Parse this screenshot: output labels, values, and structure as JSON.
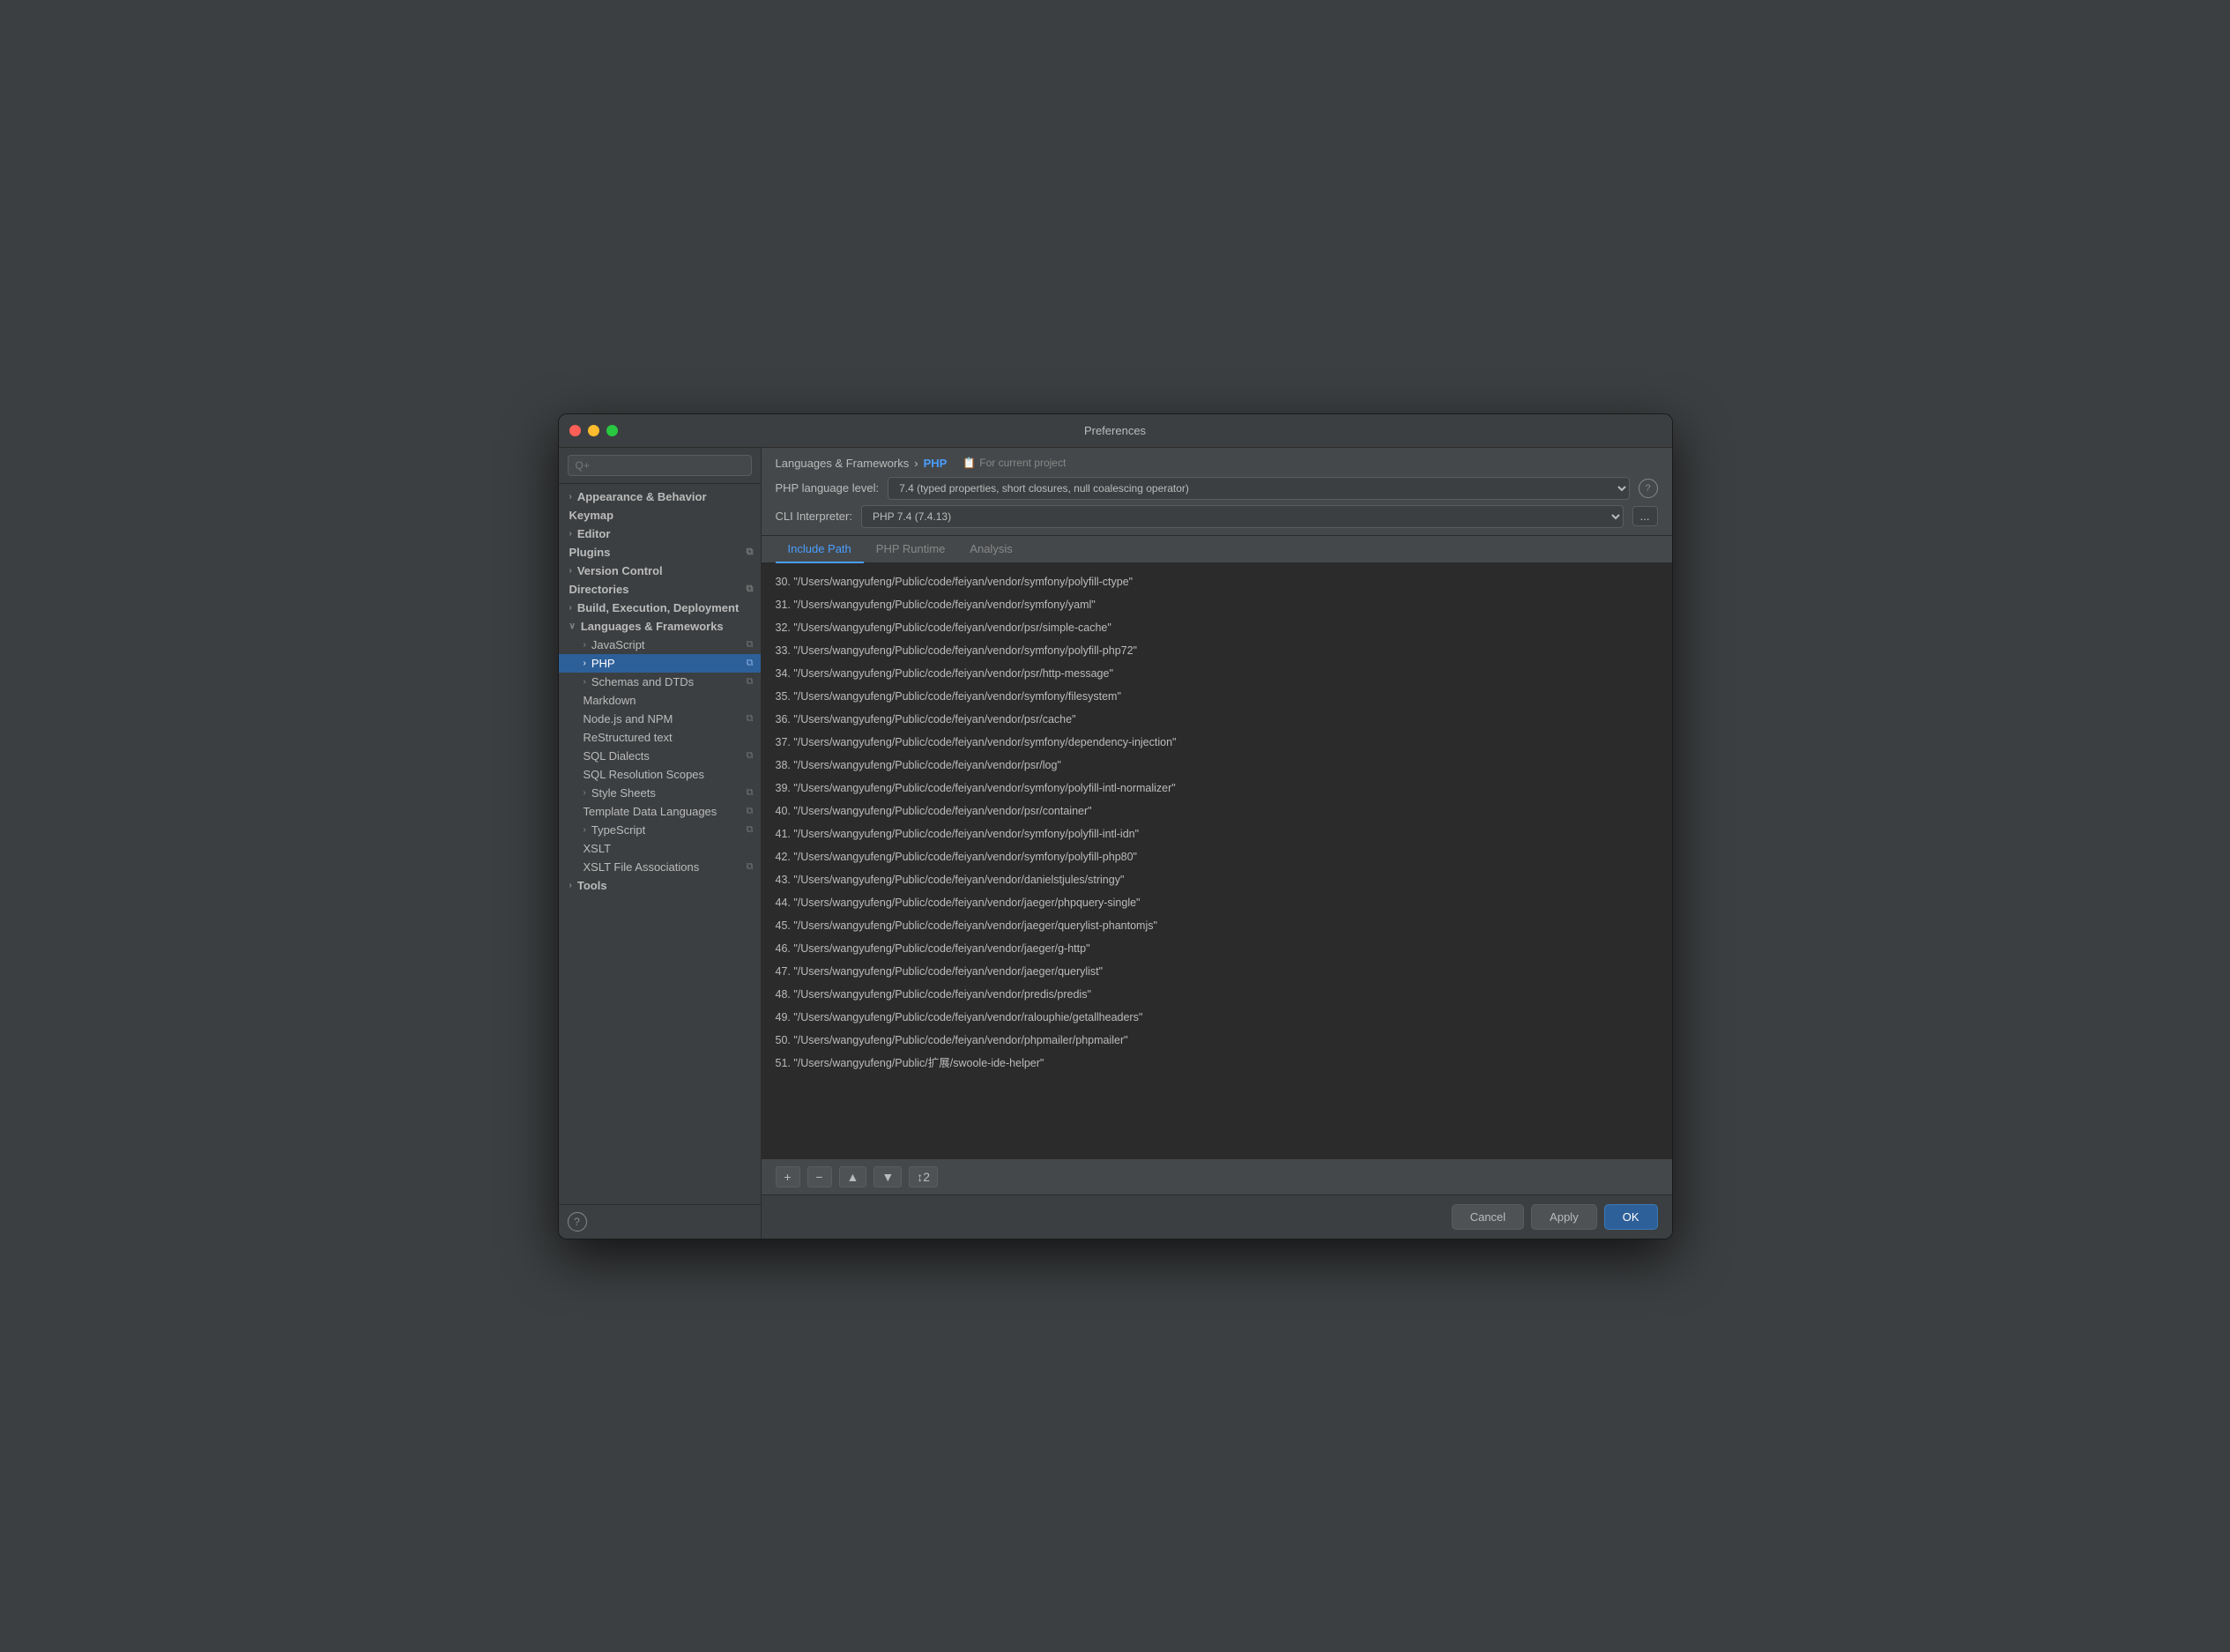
{
  "window": {
    "title": "Preferences"
  },
  "sidebar": {
    "search_placeholder": "Q+",
    "items": [
      {
        "id": "appearance",
        "label": "Appearance & Behavior",
        "level": 0,
        "expandable": true,
        "bold": true
      },
      {
        "id": "keymap",
        "label": "Keymap",
        "level": 0,
        "expandable": false,
        "bold": true
      },
      {
        "id": "editor",
        "label": "Editor",
        "level": 0,
        "expandable": true,
        "bold": true
      },
      {
        "id": "plugins",
        "label": "Plugins",
        "level": 0,
        "expandable": false,
        "bold": true,
        "has_icon": true
      },
      {
        "id": "version-control",
        "label": "Version Control",
        "level": 0,
        "expandable": true,
        "bold": true
      },
      {
        "id": "directories",
        "label": "Directories",
        "level": 0,
        "expandable": false,
        "bold": true,
        "has_icon": true
      },
      {
        "id": "build",
        "label": "Build, Execution, Deployment",
        "level": 0,
        "expandable": true,
        "bold": true
      },
      {
        "id": "languages",
        "label": "Languages & Frameworks",
        "level": 0,
        "expandable": true,
        "bold": true,
        "expanded": true
      },
      {
        "id": "javascript",
        "label": "JavaScript",
        "level": 1,
        "expandable": true,
        "has_icon": true
      },
      {
        "id": "php",
        "label": "PHP",
        "level": 1,
        "expandable": true,
        "selected": true,
        "has_icon": true
      },
      {
        "id": "schemas",
        "label": "Schemas and DTDs",
        "level": 1,
        "expandable": true,
        "has_icon": true
      },
      {
        "id": "markdown",
        "label": "Markdown",
        "level": 1,
        "expandable": false
      },
      {
        "id": "nodejs",
        "label": "Node.js and NPM",
        "level": 1,
        "expandable": false,
        "has_icon": true
      },
      {
        "id": "restructured",
        "label": "ReStructured text",
        "level": 1,
        "expandable": false
      },
      {
        "id": "sql-dialects",
        "label": "SQL Dialects",
        "level": 1,
        "expandable": false,
        "has_icon": true
      },
      {
        "id": "sql-resolution",
        "label": "SQL Resolution Scopes",
        "level": 1,
        "expandable": false
      },
      {
        "id": "stylesheets",
        "label": "Style Sheets",
        "level": 1,
        "expandable": true,
        "has_icon": true
      },
      {
        "id": "template",
        "label": "Template Data Languages",
        "level": 1,
        "expandable": false,
        "has_icon": true
      },
      {
        "id": "typescript",
        "label": "TypeScript",
        "level": 1,
        "expandable": true,
        "has_icon": true
      },
      {
        "id": "xslt",
        "label": "XSLT",
        "level": 1,
        "expandable": false
      },
      {
        "id": "xslt-file",
        "label": "XSLT File Associations",
        "level": 1,
        "expandable": false,
        "has_icon": true
      },
      {
        "id": "tools",
        "label": "Tools",
        "level": 0,
        "expandable": true,
        "bold": true
      }
    ]
  },
  "panel": {
    "breadcrumb": {
      "parent": "Languages & Frameworks",
      "separator": "›",
      "current": "PHP",
      "project_icon": "📋",
      "project_label": "For current project"
    },
    "lang_level": {
      "label": "PHP language level:",
      "value": "7.4 (typed properties, short closures, null coalescing operator)"
    },
    "cli": {
      "label": "CLI Interpreter:",
      "value": "PHP 7.4 (7.4.13)"
    },
    "tabs": [
      {
        "id": "include-path",
        "label": "Include Path",
        "active": true
      },
      {
        "id": "php-runtime",
        "label": "PHP Runtime",
        "active": false
      },
      {
        "id": "analysis",
        "label": "Analysis",
        "active": false
      }
    ],
    "paths": [
      "30.  \"/Users/wangyufeng/Public/code/feiyan/vendor/symfony/polyfill-ctype\"",
      "31.  \"/Users/wangyufeng/Public/code/feiyan/vendor/symfony/yaml\"",
      "32.  \"/Users/wangyufeng/Public/code/feiyan/vendor/psr/simple-cache\"",
      "33.  \"/Users/wangyufeng/Public/code/feiyan/vendor/symfony/polyfill-php72\"",
      "34.  \"/Users/wangyufeng/Public/code/feiyan/vendor/psr/http-message\"",
      "35.  \"/Users/wangyufeng/Public/code/feiyan/vendor/symfony/filesystem\"",
      "36.  \"/Users/wangyufeng/Public/code/feiyan/vendor/psr/cache\"",
      "37.  \"/Users/wangyufeng/Public/code/feiyan/vendor/symfony/dependency-injection\"",
      "38.  \"/Users/wangyufeng/Public/code/feiyan/vendor/psr/log\"",
      "39.  \"/Users/wangyufeng/Public/code/feiyan/vendor/symfony/polyfill-intl-normalizer\"",
      "40.  \"/Users/wangyufeng/Public/code/feiyan/vendor/psr/container\"",
      "41.  \"/Users/wangyufeng/Public/code/feiyan/vendor/symfony/polyfill-intl-idn\"",
      "42.  \"/Users/wangyufeng/Public/code/feiyan/vendor/symfony/polyfill-php80\"",
      "43.  \"/Users/wangyufeng/Public/code/feiyan/vendor/danielstjules/stringy\"",
      "44.  \"/Users/wangyufeng/Public/code/feiyan/vendor/jaeger/phpquery-single\"",
      "45.  \"/Users/wangyufeng/Public/code/feiyan/vendor/jaeger/querylist-phantomjs\"",
      "46.  \"/Users/wangyufeng/Public/code/feiyan/vendor/jaeger/g-http\"",
      "47.  \"/Users/wangyufeng/Public/code/feiyan/vendor/jaeger/querylist\"",
      "48.  \"/Users/wangyufeng/Public/code/feiyan/vendor/predis/predis\"",
      "49.  \"/Users/wangyufeng/Public/code/feiyan/vendor/ralouphie/getallheaders\"",
      "50.  \"/Users/wangyufeng/Public/code/feiyan/vendor/phpmailer/phpmailer\"",
      "51.  \"/Users/wangyufeng/Public/扩展/swoole-ide-helper\""
    ],
    "toolbar": {
      "add": "+",
      "remove": "−",
      "move_up": "▲",
      "move_down": "▼",
      "sort": "↕2"
    }
  },
  "bottom_bar": {
    "cancel": "Cancel",
    "apply": "Apply",
    "ok": "OK"
  }
}
